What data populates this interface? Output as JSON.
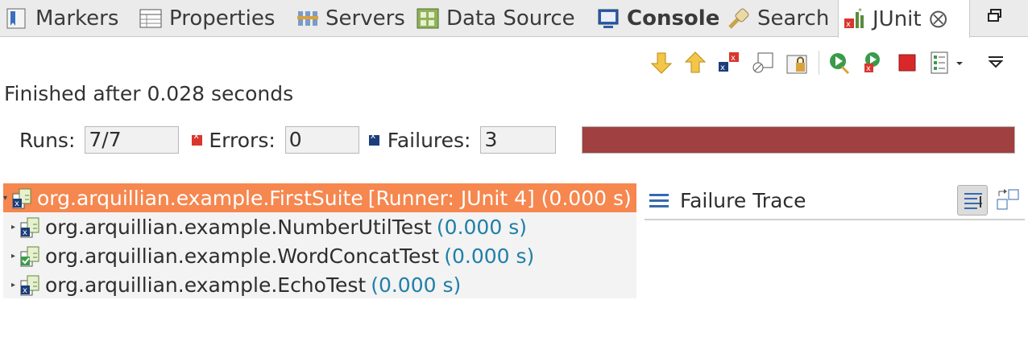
{
  "tabs": [
    {
      "label": "Markers",
      "icon": "markers-icon"
    },
    {
      "label": "Properties",
      "icon": "properties-icon"
    },
    {
      "label": "Servers",
      "icon": "servers-icon"
    },
    {
      "label": "Data Source",
      "icon": "data-source-icon"
    },
    {
      "label": "Console",
      "icon": "console-icon"
    },
    {
      "label": "Search",
      "icon": "search-icon"
    },
    {
      "label": "JUnit",
      "icon": "junit-icon",
      "close": "⨂"
    }
  ],
  "status_text": "Finished after 0.028 seconds",
  "counters": {
    "runs_label": "Runs:",
    "runs_value": "7/7",
    "errors_label": "Errors:",
    "errors_value": "0",
    "failures_label": "Failures:",
    "failures_value": "3"
  },
  "progress": {
    "fraction": 1.0,
    "color": "#a04040"
  },
  "tree": [
    {
      "name": "org.arquillian.example.FirstSuite",
      "suffix": "[Runner: JUnit 4] (0.000 s)",
      "status": "failure",
      "selected": true
    },
    {
      "name": "org.arquillian.example.NumberUtilTest",
      "suffix": "(0.000 s)",
      "status": "failure",
      "selected": false
    },
    {
      "name": "org.arquillian.example.WordConcatTest",
      "suffix": "(0.000 s)",
      "status": "success",
      "selected": false
    },
    {
      "name": "org.arquillian.example.EchoTest",
      "suffix": "(0.000 s)",
      "status": "failure",
      "selected": false
    }
  ],
  "failure_trace": {
    "title": "Failure Trace"
  },
  "colors": {
    "selection": "#f5874f",
    "time": "#1f7fa8",
    "failure_bar": "#a04040"
  }
}
